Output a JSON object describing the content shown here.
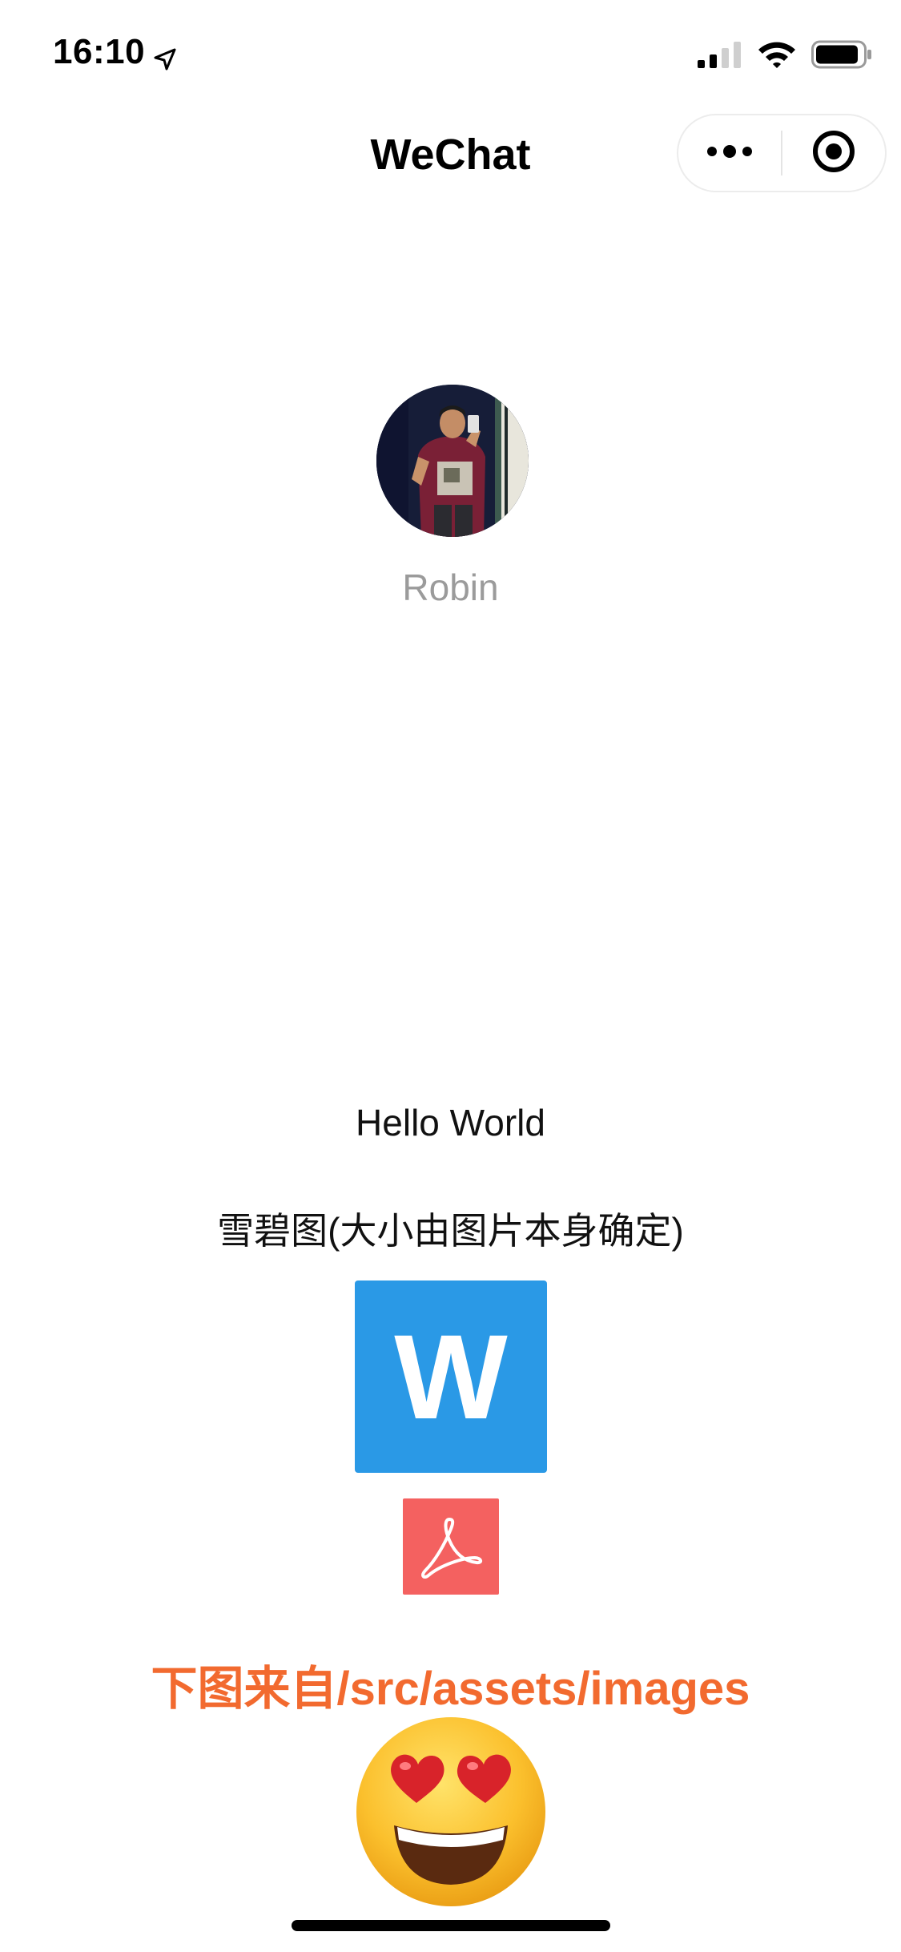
{
  "status_bar": {
    "time": "16:10",
    "location_icon": "location-arrow-icon",
    "signal_icon": "cellular-signal-icon",
    "wifi_icon": "wifi-icon",
    "battery_icon": "battery-icon"
  },
  "nav": {
    "title": "WeChat",
    "more_icon": "more-dots-icon",
    "close_icon": "target-close-icon"
  },
  "profile": {
    "avatar_icon": "user-avatar-photo",
    "nickname": "Robin"
  },
  "content": {
    "hello": "Hello World",
    "sprite_caption": "雪碧图(大小由图片本身确定)",
    "word_icon_letter": "W",
    "pdf_icon": "adobe-pdf-icon",
    "assets_caption": "下图来自/src/assets/images",
    "emoji_icon": "heart-eyes-emoji"
  },
  "colors": {
    "word_blue": "#2a99e6",
    "pdf_red": "#f46160",
    "assets_orange": "#f26a2f",
    "nickname_gray": "#9b9b9b"
  }
}
